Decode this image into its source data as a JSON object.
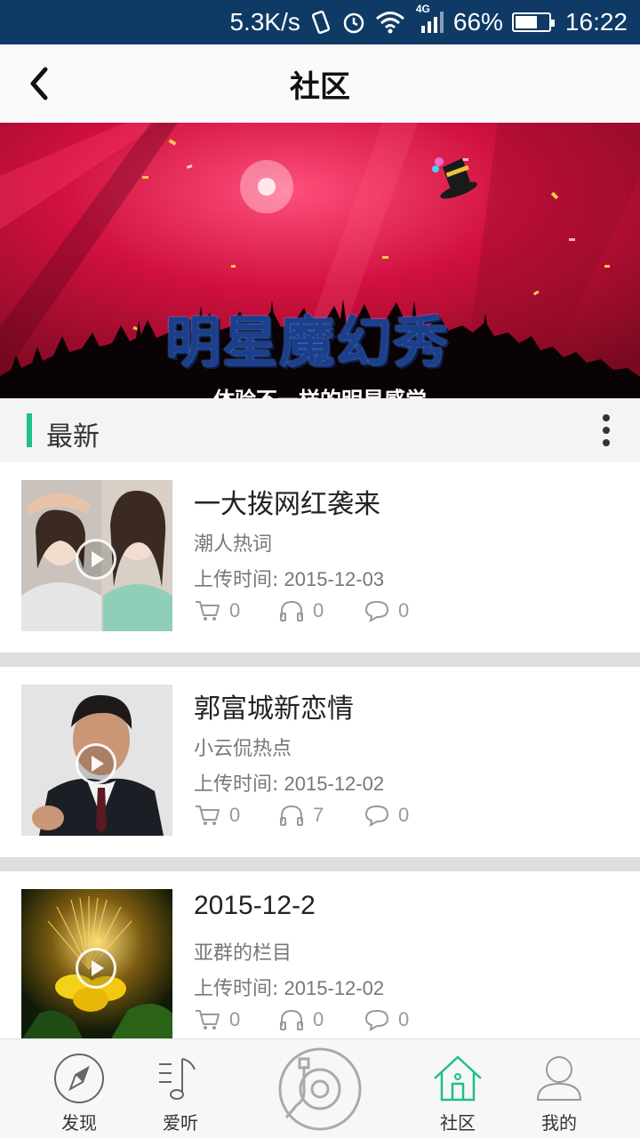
{
  "status_bar": {
    "speed": "5.3K/s",
    "network": "4G",
    "battery_percent": "66%",
    "battery_level": 0.66,
    "time": "16:22"
  },
  "header": {
    "title": "社区",
    "back_icon": "chevron-left-icon"
  },
  "banner": {
    "title": "明星魔幻秀",
    "subtitle": "体验不一样的明星感觉",
    "dot_count": 4,
    "active_dot": 3
  },
  "section": {
    "title": "最新",
    "accent_color": "#1fbf8f"
  },
  "items": [
    {
      "title": "一大拨网红袭来",
      "subtitle": "潮人热词",
      "time_label": "上传时间:",
      "time": "2015-12-03",
      "cart_count": "0",
      "listen_count": "0",
      "comment_count": "0"
    },
    {
      "title": "郭富城新恋情",
      "subtitle": "小云侃热点",
      "time_label": "上传时间:",
      "time": "2015-12-02",
      "cart_count": "0",
      "listen_count": "7",
      "comment_count": "0"
    },
    {
      "title": "2015-12-2",
      "subtitle": "亚群的栏目",
      "time_label": "上传时间:",
      "time": "2015-12-02",
      "cart_count": "0",
      "listen_count": "0",
      "comment_count": "0"
    }
  ],
  "bottom_nav": {
    "discover": "发现",
    "listen": "爱听",
    "community": "社区",
    "mine": "我的",
    "active": "community",
    "active_color": "#1fbf8f"
  }
}
